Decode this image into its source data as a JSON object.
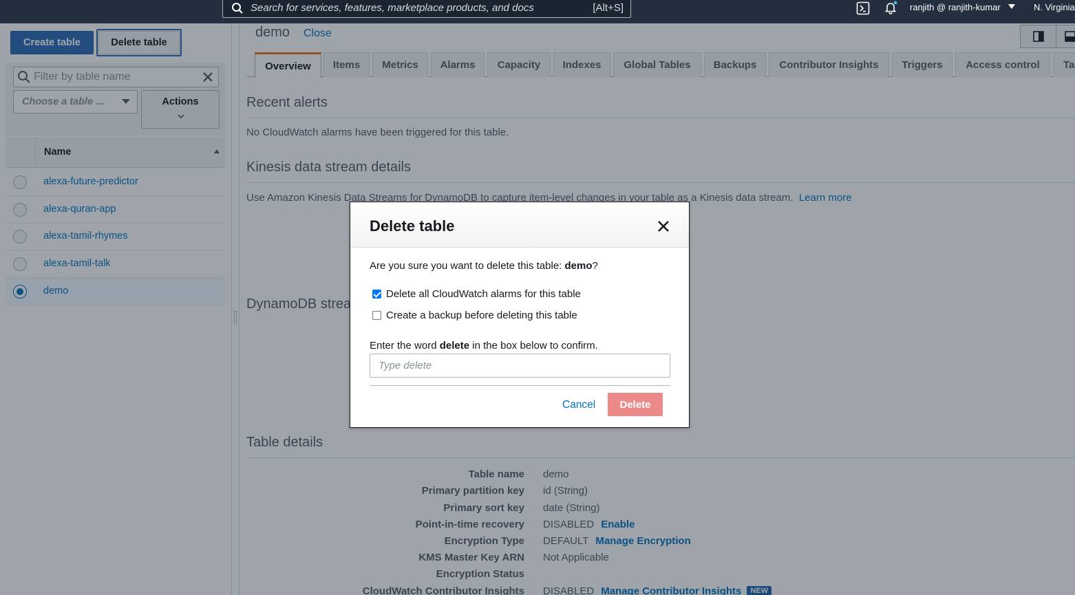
{
  "topnav": {
    "search_placeholder": "Search for services, features, marketplace products, and docs",
    "search_shortcut": "[Alt+S]",
    "user": "ranjith @ ranjith-kumar",
    "region": "N. Virginia"
  },
  "sidebar": {
    "create_button": "Create table",
    "delete_button": "Delete table",
    "filter_placeholder": "Filter by table name",
    "choose_placeholder": "Choose a table ...",
    "actions_label": "Actions",
    "column_name": "Name",
    "tables": [
      {
        "name": "alexa-future-predictor",
        "selected": false
      },
      {
        "name": "alexa-quran-app",
        "selected": false
      },
      {
        "name": "alexa-tamil-rhymes",
        "selected": false
      },
      {
        "name": "alexa-tamil-talk",
        "selected": false
      },
      {
        "name": "demo",
        "selected": true
      }
    ]
  },
  "main": {
    "title": "demo",
    "close_label": "Close",
    "tabs": [
      {
        "label": "Overview",
        "active": true
      },
      {
        "label": "Items"
      },
      {
        "label": "Metrics"
      },
      {
        "label": "Alarms"
      },
      {
        "label": "Capacity"
      },
      {
        "label": "Indexes"
      },
      {
        "label": "Global Tables"
      },
      {
        "label": "Backups"
      },
      {
        "label": "Contributor Insights"
      },
      {
        "label": "Triggers"
      },
      {
        "label": "Access control"
      },
      {
        "label": "Tag"
      }
    ],
    "recent_alerts": {
      "title": "Recent alerts",
      "text": "No CloudWatch alarms have been triggered for this table."
    },
    "kinesis": {
      "title": "Kinesis data stream details",
      "text": "Use Amazon Kinesis Data Streams for DynamoDB to capture item-level changes in your table as a Kinesis data stream.",
      "link": "Learn more"
    },
    "dynamodb_stream": {
      "title": "DynamoDB strea"
    },
    "table_details": {
      "title": "Table details",
      "rows": [
        {
          "label": "Table name",
          "value": "demo",
          "link": ""
        },
        {
          "label": "Primary partition key",
          "value": "id (String)",
          "link": ""
        },
        {
          "label": "Primary sort key",
          "value": "date (String)",
          "link": ""
        },
        {
          "label": "Point-in-time recovery",
          "value": "DISABLED",
          "link": "Enable"
        },
        {
          "label": "Encryption Type",
          "value": "DEFAULT",
          "link": "Manage Encryption"
        },
        {
          "label": "KMS Master Key ARN",
          "value": "Not Applicable",
          "link": ""
        },
        {
          "label": "Encryption Status",
          "value": "",
          "link": ""
        },
        {
          "label": "CloudWatch Contributor Insights",
          "value": "DISABLED",
          "link": "Manage Contributor Insights",
          "badge": "NEW"
        }
      ]
    }
  },
  "modal": {
    "title": "Delete table",
    "question_prefix": "Are you sure you want to delete this table: ",
    "question_table": "demo",
    "question_suffix": "?",
    "option_alarms": "Delete all CloudWatch alarms for this table",
    "option_alarms_checked": true,
    "option_backup": "Create a backup before deleting this table",
    "option_backup_checked": false,
    "confirm_prefix": "Enter the word ",
    "confirm_word": "delete",
    "confirm_suffix": " in the box below to confirm.",
    "confirm_placeholder": "Type delete",
    "cancel_label": "Cancel",
    "delete_label": "Delete"
  }
}
